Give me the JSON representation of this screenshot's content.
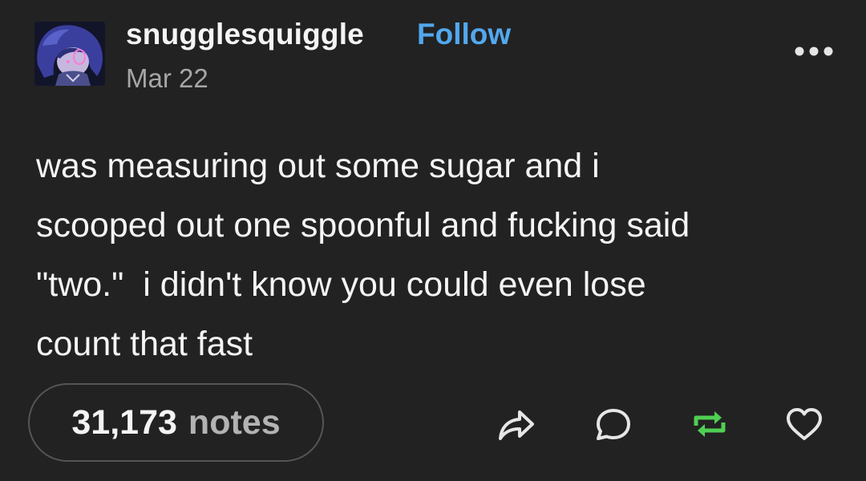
{
  "header": {
    "username": "snugglesquiggle",
    "follow_label": "Follow",
    "date": "Mar 22",
    "avatar_icon": "avatar-icon",
    "more_icon": "more-options-icon"
  },
  "post": {
    "lines": [
      "was measuring out some sugar and i",
      "scooped out one spoonful and fucking said",
      "\"two.\"  i didn't know you could even lose",
      "count that fast"
    ]
  },
  "footer": {
    "notes_count": "31,173",
    "notes_label": "notes",
    "actions": [
      "share-icon",
      "reply-icon",
      "reblog-icon",
      "like-icon"
    ]
  },
  "colors": {
    "background": "#222222",
    "follow": "#52a8ee",
    "reblog": "#4fcf53",
    "muted": "#a6a6a6"
  }
}
